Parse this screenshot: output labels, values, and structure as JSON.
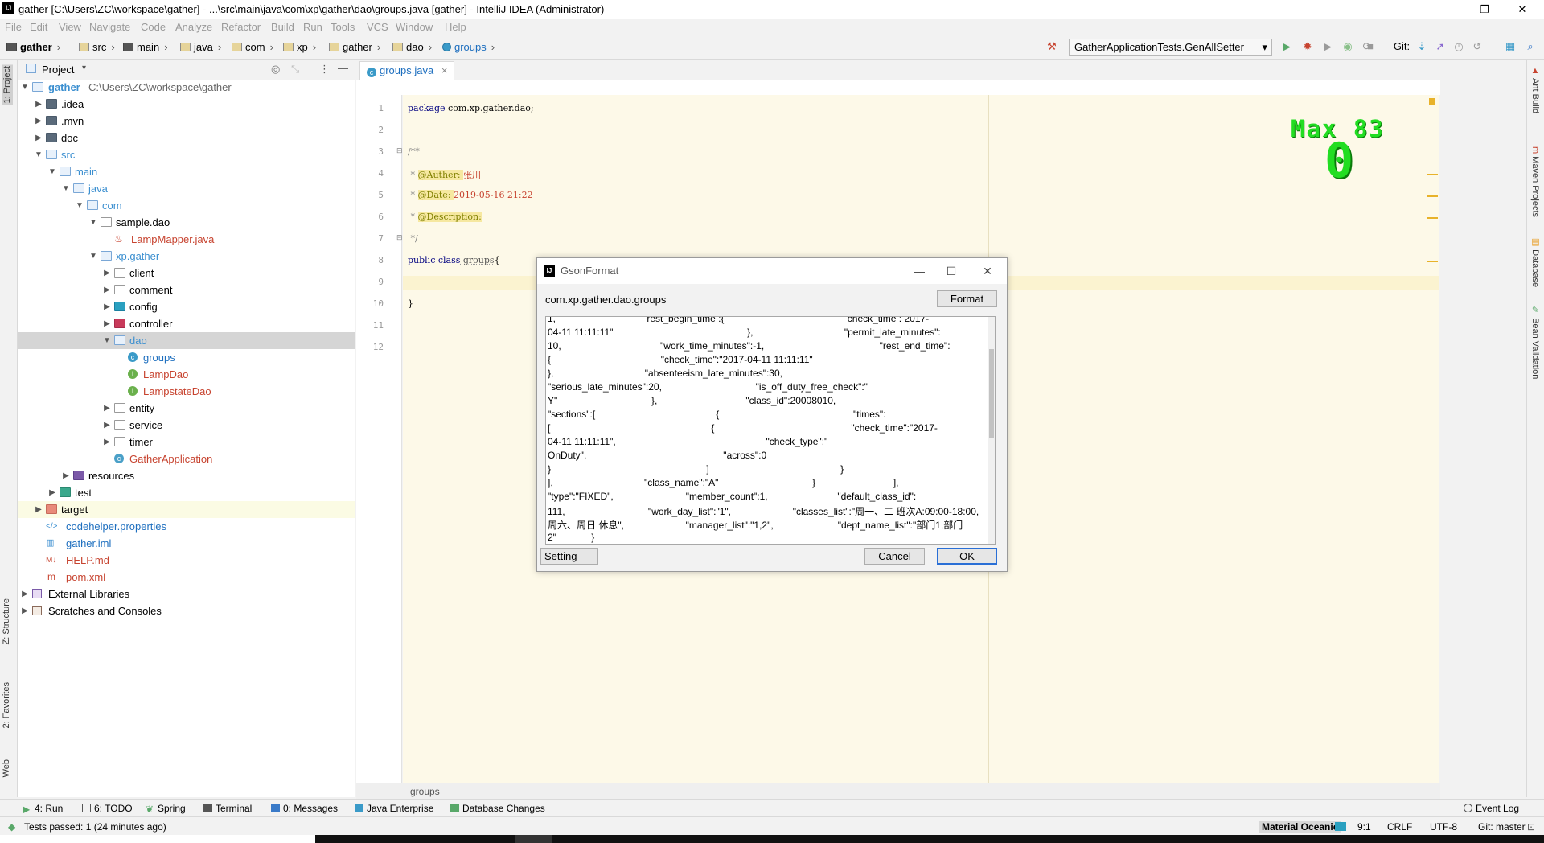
{
  "window": {
    "title": "gather [C:\\Users\\ZC\\workspace\\gather] - ...\\src\\main\\java\\com\\xp\\gather\\dao\\groups.java [gather] - IntelliJ IDEA (Administrator)",
    "app_icon": "IJ",
    "minimize": "—",
    "maximize": "❐",
    "close": "✕"
  },
  "menu": [
    "File",
    "Edit",
    "View",
    "Navigate",
    "Code",
    "Analyze",
    "Refactor",
    "Build",
    "Run",
    "Tools",
    "VCS",
    "Window",
    "Help"
  ],
  "breadcrumbs": [
    "gather",
    "src",
    "main",
    "java",
    "com",
    "xp",
    "gather",
    "dao",
    "groups"
  ],
  "toolbar": {
    "run_config": "GatherApplicationTests.GenAllSetter",
    "git_label": "Git:"
  },
  "left_stripe": {
    "project": "1: Project",
    "structure": "Z: Structure",
    "favorites": "2: Favorites",
    "web": "Web"
  },
  "project_panel": {
    "title": "Project",
    "rows": [
      {
        "label": "gather",
        "extra": "C:\\Users\\ZC\\workspace\\gather"
      },
      {
        "label": ".idea"
      },
      {
        "label": ".mvn"
      },
      {
        "label": "doc"
      },
      {
        "label": "src"
      },
      {
        "label": "main"
      },
      {
        "label": "java"
      },
      {
        "label": "com"
      },
      {
        "label": "sample.dao"
      },
      {
        "label": "LampMapper.java"
      },
      {
        "label": "xp.gather"
      },
      {
        "label": "client"
      },
      {
        "label": "comment"
      },
      {
        "label": "config"
      },
      {
        "label": "controller"
      },
      {
        "label": "dao"
      },
      {
        "label": "groups"
      },
      {
        "label": "LampDao"
      },
      {
        "label": "LampstateDao"
      },
      {
        "label": "entity"
      },
      {
        "label": "service"
      },
      {
        "label": "timer"
      },
      {
        "label": "GatherApplication"
      },
      {
        "label": "resources"
      },
      {
        "label": "test"
      },
      {
        "label": "target"
      },
      {
        "label": "codehelper.properties"
      },
      {
        "label": "gather.iml"
      },
      {
        "label": "HELP.md"
      },
      {
        "label": "pom.xml"
      },
      {
        "label": "External Libraries"
      },
      {
        "label": "Scratches and Consoles"
      }
    ]
  },
  "editor": {
    "tab": "groups.java",
    "tab_close": "×",
    "footer": "groups",
    "lines": [
      "1",
      "2",
      "3",
      "4",
      "5",
      "6",
      "7",
      "8",
      "9",
      "10",
      "11",
      "12"
    ],
    "code": {
      "l1_kw": "package",
      "l1_rest": " com.xp.gather.dao;",
      "l3": "/**",
      "l4_star": " * ",
      "l4_tag": "@Auther",
      "l4_colon": ": ",
      "l4_val": "张川",
      "l5_star": " * ",
      "l5_tag": "@Date",
      "l5_colon": ": ",
      "l5_val": "2019-05-16 21:22",
      "l6_star": " * ",
      "l6_tag": "@Description",
      "l6_colon": ":",
      "l7": " */",
      "l8_kw": "public class",
      "l8_name": " groups",
      "l8_brace": "{",
      "l10": "}"
    }
  },
  "overlay": {
    "max_label": "Max 83",
    "counter": "0"
  },
  "right_stripe": {
    "ant": "Ant Build",
    "maven": "Maven Projects",
    "database": "Database",
    "bean": "Bean Validation"
  },
  "dialog": {
    "title": "GsonFormat",
    "class_name": "com.xp.gather.dao.groups",
    "format_button": "Format",
    "setting_button": "Setting",
    "cancel_button": "Cancel",
    "ok_button": "OK",
    "json_lines": [
      "1,                                  rest_begin_time :{                                              check_time : 2017-",
      "04-11 11:11:11\"                                                  },                                  \"permit_late_minutes\":",
      "10,                                     \"work_time_minutes\":-1,                                           \"rest_end_time\":",
      "{                                         \"check_time\":\"2017-04-11 11:11:11\"",
      "},                                  \"absenteeism_late_minutes\":30,",
      "\"serious_late_minutes\":20,                                   \"is_off_duty_free_check\":\"",
      "Y\"                                   },                                 \"class_id\":20008010,",
      "\"sections\":[                                             {                                                  \"times\":",
      "[                                                            {                                                   \"check_time\":\"2017-",
      "04-11 11:11:11\",                                                        \"check_type\":\"",
      "OnDuty\",                                                   \"across\":0",
      "}                                                          ]                                                 }",
      "],                                  \"class_name\":\"A\"                                   }                             ],",
      "\"type\":\"FIXED\",                           \"member_count\":1,                          \"default_class_id\":",
      "111,                               \"work_day_list\":\"1\",                       \"classes_list\":\"周一、二 班次A:09:00-18:00,",
      "周六、周日 休息\",                       \"manager_list\":\"1,2\",                        \"dept_name_list\":\"部门1,部门",
      "2\"             }"
    ]
  },
  "bottom_tabs": [
    "4: Run",
    "6: TODO",
    "Spring",
    "Terminal",
    "0: Messages",
    "Java Enterprise",
    "Database Changes",
    "Event Log"
  ],
  "status": {
    "message": "Tests passed: 1 (24 minutes ago)",
    "theme": "Material Oceanic",
    "position": "9:1",
    "line_sep": "CRLF",
    "encoding": "UTF-8",
    "git": "Git: master"
  },
  "colors": {
    "editor_bg": "#fdf9e8",
    "overlay_green": "#22dd22",
    "annotation_bg": "#f6e8a0",
    "selection": "#d5d5d5"
  }
}
